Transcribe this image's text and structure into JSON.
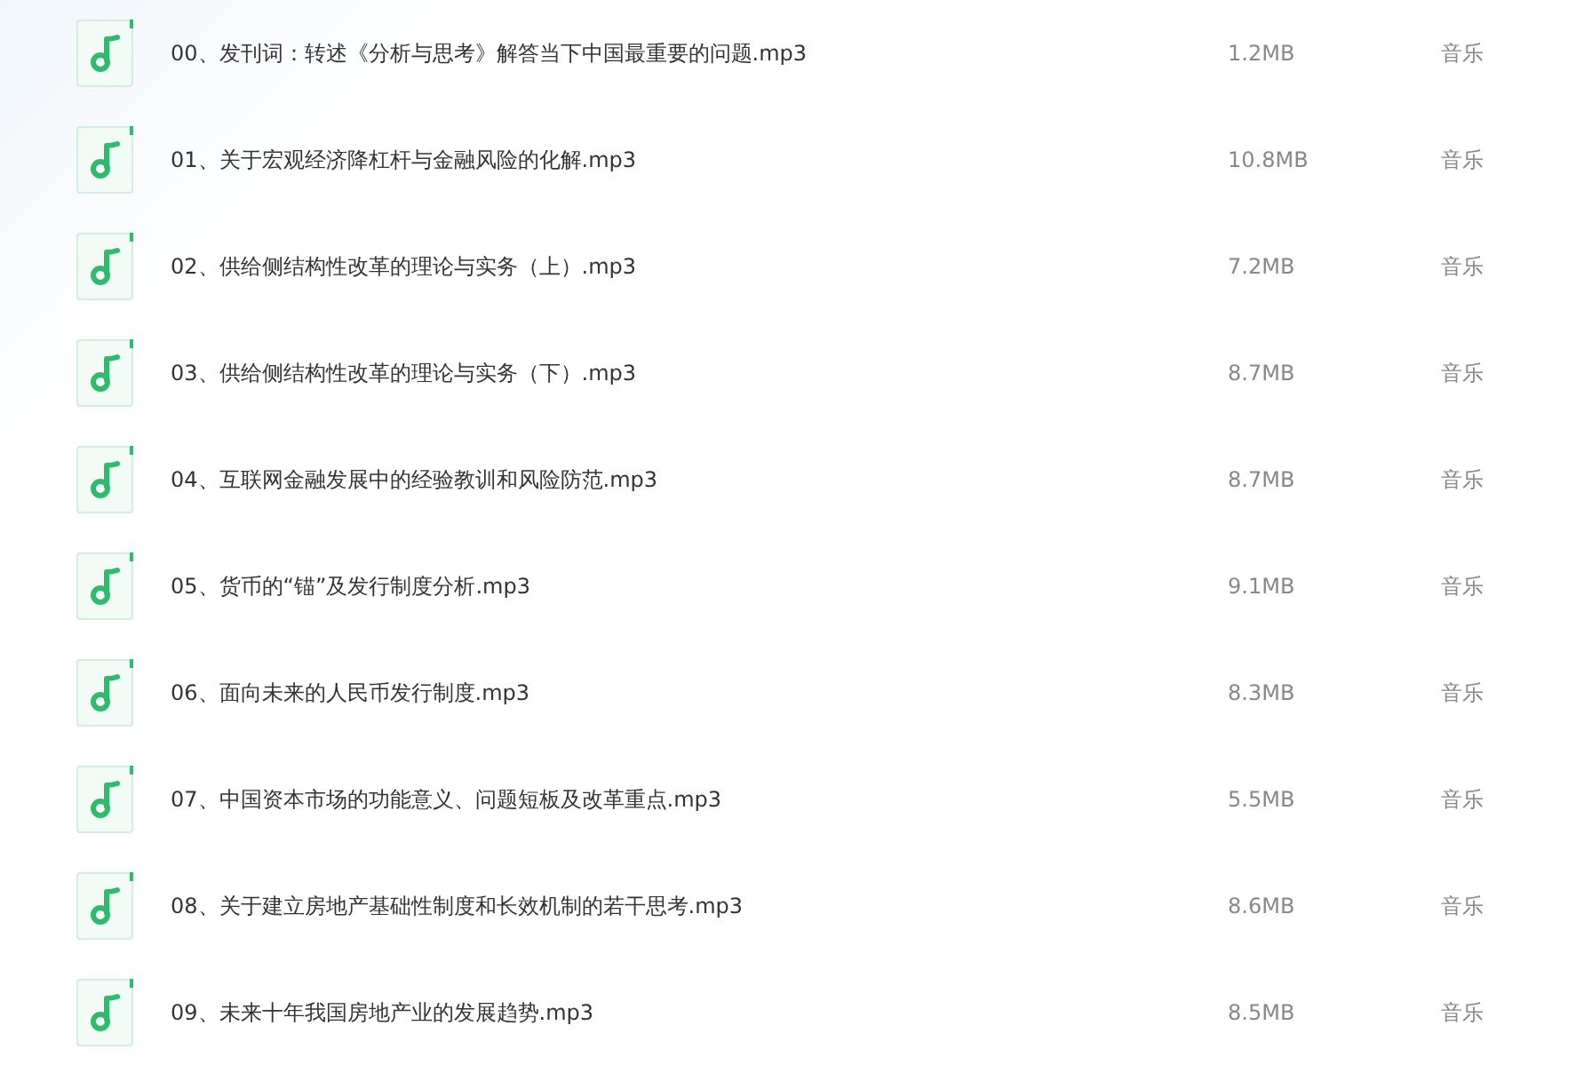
{
  "files": [
    {
      "name": "00、发刊词：转述《分析与思考》解答当下中国最重要的问题.mp3",
      "size": "1.2MB",
      "type": "音乐"
    },
    {
      "name": "01、关于宏观经济降杠杆与金融风险的化解.mp3",
      "size": "10.8MB",
      "type": "音乐"
    },
    {
      "name": "02、供给侧结构性改革的理论与实务（上）.mp3",
      "size": "7.2MB",
      "type": "音乐"
    },
    {
      "name": "03、供给侧结构性改革的理论与实务（下）.mp3",
      "size": "8.7MB",
      "type": "音乐"
    },
    {
      "name": "04、互联网金融发展中的经验教训和风险防范.mp3",
      "size": "8.7MB",
      "type": "音乐"
    },
    {
      "name": "05、货币的“锚”及发行制度分析.mp3",
      "size": "9.1MB",
      "type": "音乐"
    },
    {
      "name": "06、面向未来的人民币发行制度.mp3",
      "size": "8.3MB",
      "type": "音乐"
    },
    {
      "name": "07、中国资本市场的功能意义、问题短板及改革重点.mp3",
      "size": "5.5MB",
      "type": "音乐"
    },
    {
      "name": "08、关于建立房地产基础性制度和长效机制的若干思考.mp3",
      "size": "8.6MB",
      "type": "音乐"
    },
    {
      "name": "09、未来十年我国房地产业的发展趋势.mp3",
      "size": "8.5MB",
      "type": "音乐"
    }
  ]
}
